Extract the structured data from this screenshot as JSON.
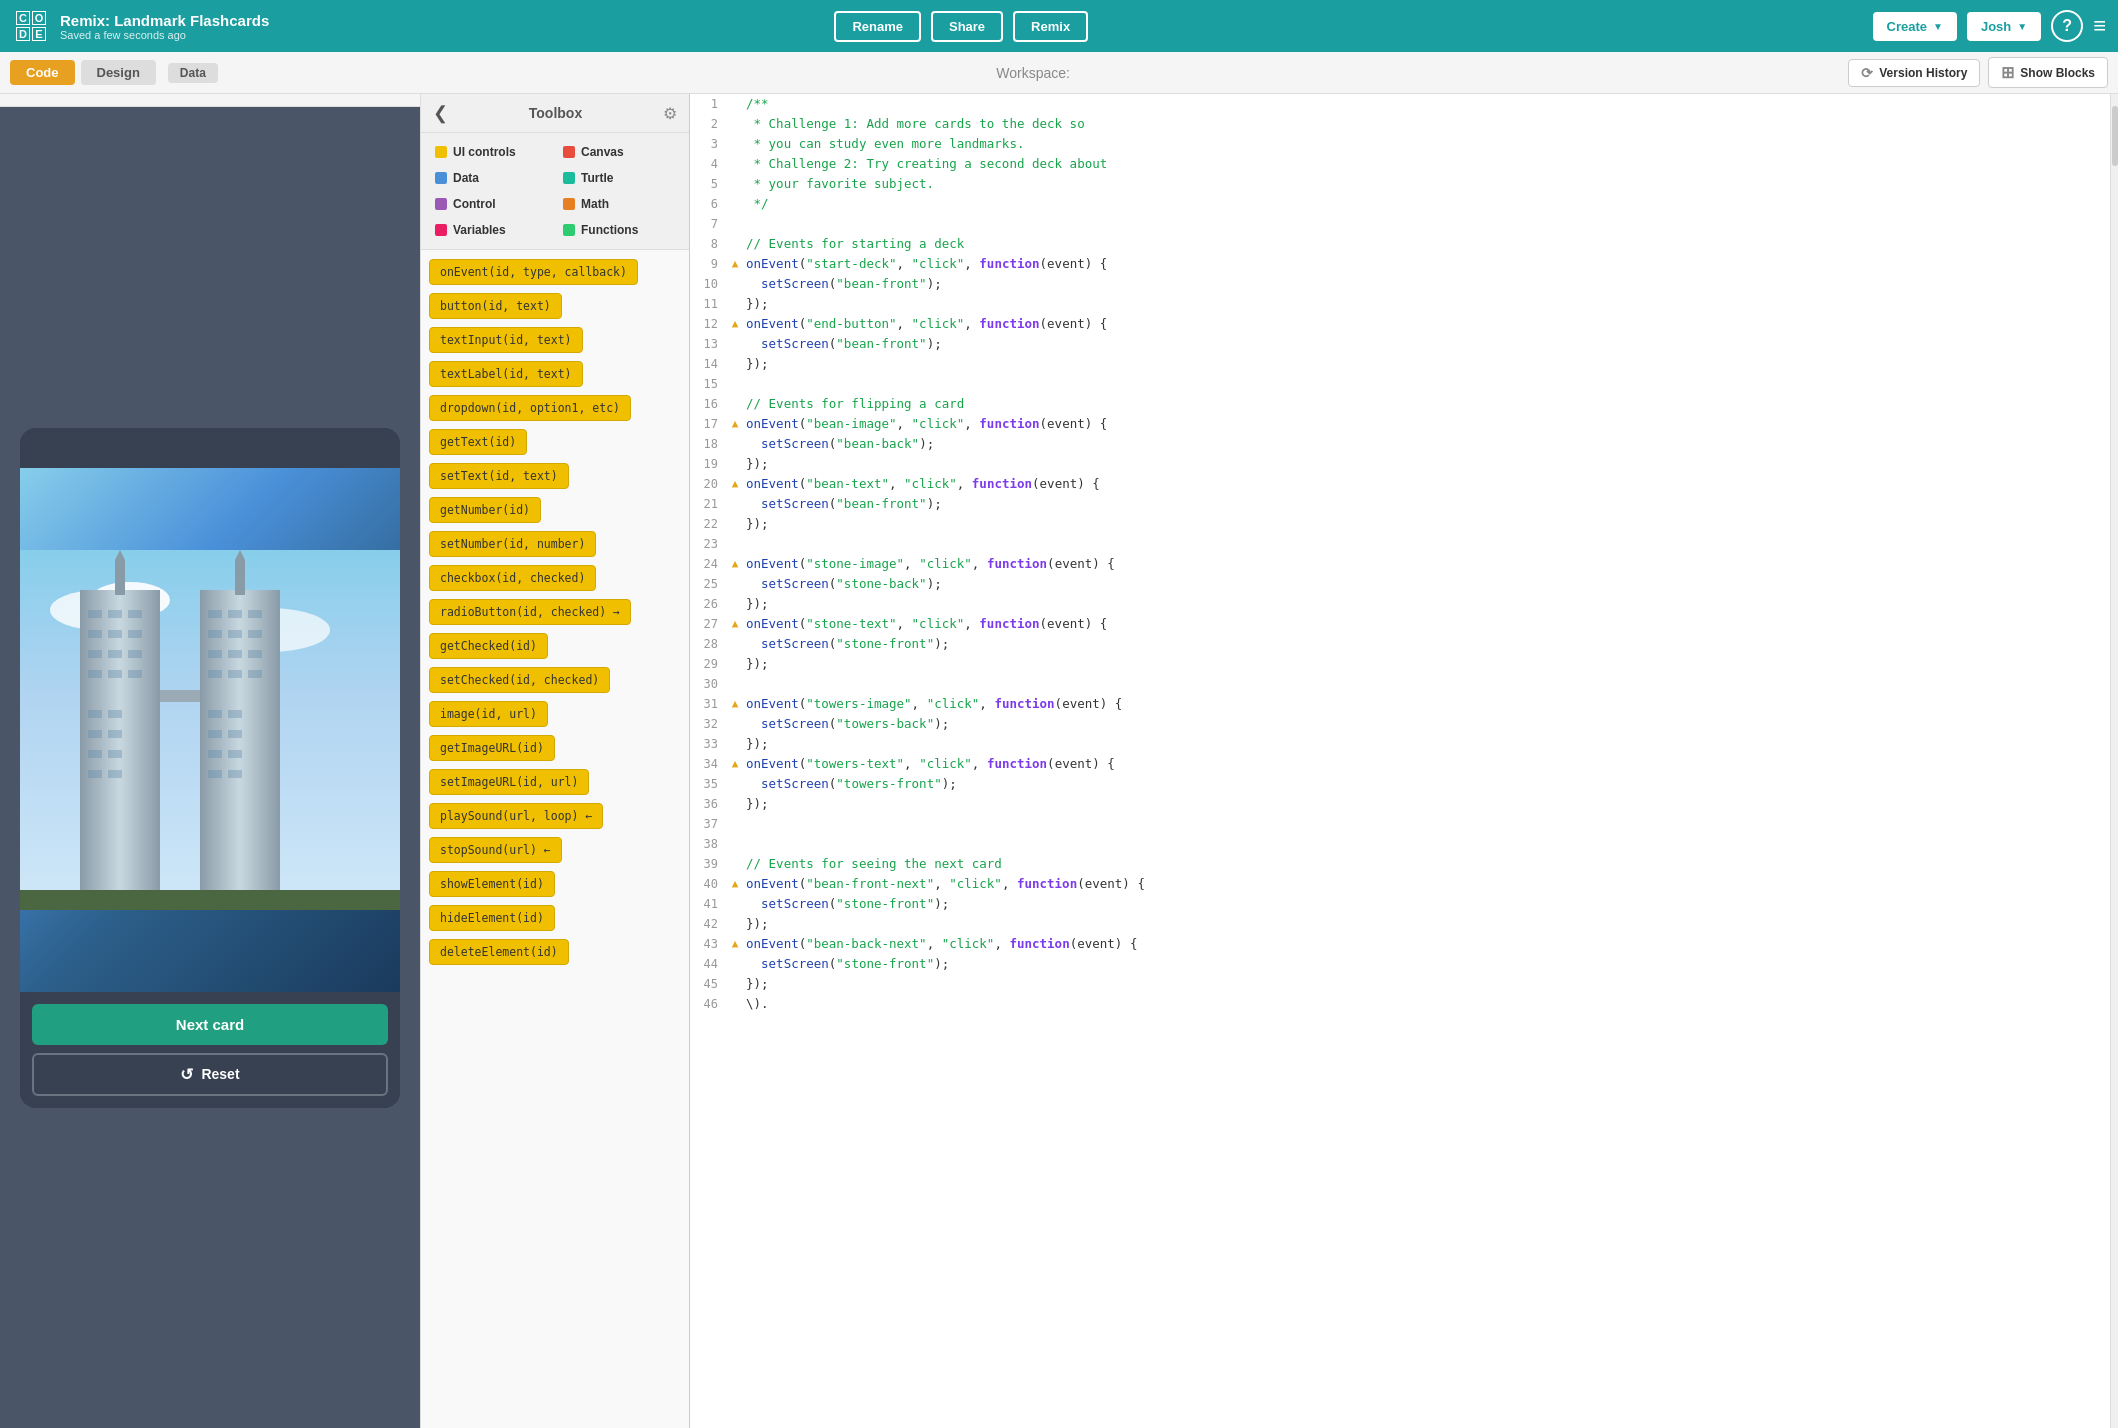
{
  "topNav": {
    "logoLetters": [
      "C",
      "O",
      "D",
      "E"
    ],
    "projectTitle": "Remix: Landmark Flashcards",
    "projectSubtitle": "Saved a few seconds ago",
    "renameLabel": "Rename",
    "shareLabel": "Share",
    "remixLabel": "Remix",
    "createLabel": "Create",
    "userLabel": "Josh",
    "helpLabel": "?",
    "menuLabel": "≡"
  },
  "secondBar": {
    "codeTab": "Code",
    "designTab": "Design",
    "dataTab": "Data",
    "workspaceLabel": "Workspace:",
    "versionHistoryLabel": "Version History",
    "showBlocksLabel": "Show Blocks"
  },
  "phone": {
    "nextCardLabel": "Next card",
    "resetLabel": "Reset"
  },
  "toolbox": {
    "title": "Toolbox",
    "categories": [
      {
        "label": "UI controls",
        "color": "yellow"
      },
      {
        "label": "Canvas",
        "color": "red"
      },
      {
        "label": "Data",
        "color": "blue"
      },
      {
        "label": "Turtle",
        "color": "teal"
      },
      {
        "label": "Control",
        "color": "purple"
      },
      {
        "label": "Math",
        "color": "orange"
      },
      {
        "label": "Variables",
        "color": "pink"
      },
      {
        "label": "Functions",
        "color": "green"
      }
    ],
    "blocks": [
      "onEvent(id, type, callback)",
      "button(id, text)",
      "textInput(id, text)",
      "textLabel(id, text)",
      "dropdown(id, option1, etc)",
      "getText(id)",
      "setText(id, text)",
      "getNumber(id)",
      "setNumber(id, number)",
      "checkbox(id, checked)",
      "radioButton(id, checked) →",
      "getChecked(id)",
      "setChecked(id, checked)",
      "image(id, url)",
      "getImageURL(id)",
      "setImageURL(id, url)",
      "playSound(url, loop) ←",
      "stopSound(url) ←",
      "showElement(id)",
      "hideElement(id)",
      "deleteElement(id)"
    ]
  },
  "codeLines": [
    {
      "num": 1,
      "warn": false,
      "code": "/**"
    },
    {
      "num": 2,
      "warn": false,
      "code": " * Challenge 1: Add more cards to the deck so",
      "comment": true
    },
    {
      "num": 3,
      "warn": false,
      "code": " * you can study even more landmarks.",
      "comment": true
    },
    {
      "num": 4,
      "warn": false,
      "code": " * Challenge 2: Try creating a second deck about",
      "comment": true
    },
    {
      "num": 5,
      "warn": false,
      "code": " * your favorite subject.",
      "comment": true
    },
    {
      "num": 6,
      "warn": false,
      "code": " */"
    },
    {
      "num": 7,
      "warn": false,
      "code": ""
    },
    {
      "num": 8,
      "warn": false,
      "code": "// Events for starting a deck",
      "comment": true
    },
    {
      "num": 9,
      "warn": true,
      "code": "onEvent(\"start-deck\", \"click\", function(event) {",
      "type": "onEvent"
    },
    {
      "num": 10,
      "warn": false,
      "code": "  setScreen(\"bean-front\");",
      "type": "setScreen"
    },
    {
      "num": 11,
      "warn": false,
      "code": "});"
    },
    {
      "num": 12,
      "warn": true,
      "code": "onEvent(\"end-button\", \"click\", function(event) {",
      "type": "onEvent"
    },
    {
      "num": 13,
      "warn": false,
      "code": "  setScreen(\"bean-front\");",
      "type": "setScreen"
    },
    {
      "num": 14,
      "warn": false,
      "code": "});"
    },
    {
      "num": 15,
      "warn": false,
      "code": ""
    },
    {
      "num": 16,
      "warn": false,
      "code": "// Events for flipping a card",
      "comment": true
    },
    {
      "num": 17,
      "warn": true,
      "code": "onEvent(\"bean-image\", \"click\", function(event) {",
      "type": "onEvent"
    },
    {
      "num": 18,
      "warn": false,
      "code": "  setScreen(\"bean-back\");",
      "type": "setScreen"
    },
    {
      "num": 19,
      "warn": false,
      "code": "});"
    },
    {
      "num": 20,
      "warn": true,
      "code": "onEvent(\"bean-text\", \"click\", function(event) {",
      "type": "onEvent"
    },
    {
      "num": 21,
      "warn": false,
      "code": "  setScreen(\"bean-front\");",
      "type": "setScreen"
    },
    {
      "num": 22,
      "warn": false,
      "code": "});"
    },
    {
      "num": 23,
      "warn": false,
      "code": ""
    },
    {
      "num": 24,
      "warn": true,
      "code": "onEvent(\"stone-image\", \"click\", function(event) {",
      "type": "onEvent"
    },
    {
      "num": 25,
      "warn": false,
      "code": "  setScreen(\"stone-back\");",
      "type": "setScreen"
    },
    {
      "num": 26,
      "warn": false,
      "code": "});"
    },
    {
      "num": 27,
      "warn": true,
      "code": "onEvent(\"stone-text\", \"click\", function(event) {",
      "type": "onEvent"
    },
    {
      "num": 28,
      "warn": false,
      "code": "  setScreen(\"stone-front\");",
      "type": "setScreen"
    },
    {
      "num": 29,
      "warn": false,
      "code": "});"
    },
    {
      "num": 30,
      "warn": false,
      "code": ""
    },
    {
      "num": 31,
      "warn": true,
      "code": "onEvent(\"towers-image\", \"click\", function(event) {",
      "type": "onEvent"
    },
    {
      "num": 32,
      "warn": false,
      "code": "  setScreen(\"towers-back\");",
      "type": "setScreen"
    },
    {
      "num": 33,
      "warn": false,
      "code": "});"
    },
    {
      "num": 34,
      "warn": true,
      "code": "onEvent(\"towers-text\", \"click\", function(event) {",
      "type": "onEvent"
    },
    {
      "num": 35,
      "warn": false,
      "code": "  setScreen(\"towers-front\");",
      "type": "setScreen"
    },
    {
      "num": 36,
      "warn": false,
      "code": "});"
    },
    {
      "num": 37,
      "warn": false,
      "code": ""
    },
    {
      "num": 38,
      "warn": false,
      "code": ""
    },
    {
      "num": 39,
      "warn": false,
      "code": "// Events for seeing the next card",
      "comment": true
    },
    {
      "num": 40,
      "warn": true,
      "code": "onEvent(\"bean-front-next\", \"click\", function(event) {",
      "type": "onEvent"
    },
    {
      "num": 41,
      "warn": false,
      "code": "  setScreen(\"stone-front\");",
      "type": "setScreen"
    },
    {
      "num": 42,
      "warn": false,
      "code": "});"
    },
    {
      "num": 43,
      "warn": true,
      "code": "onEvent(\"bean-back-next\", \"click\", function(event) {",
      "type": "onEvent"
    },
    {
      "num": 44,
      "warn": false,
      "code": "  setScreen(\"stone-front\");",
      "type": "setScreen"
    },
    {
      "num": 45,
      "warn": false,
      "code": "});"
    },
    {
      "num": 46,
      "warn": false,
      "code": "\\)."
    }
  ]
}
